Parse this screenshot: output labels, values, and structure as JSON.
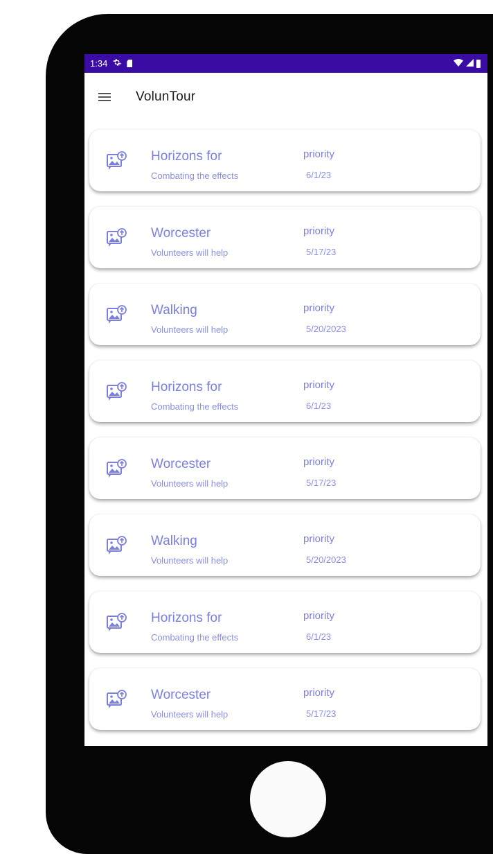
{
  "status_bar": {
    "time": "1:34"
  },
  "app_bar": {
    "title": "VolunTour"
  },
  "colors": {
    "status_bar": "#3a0ca3",
    "accent_text": "#7b7fe0"
  },
  "icons": {
    "menu": "hamburger-menu-icon",
    "thumb": "image-upload-icon"
  },
  "items": [
    {
      "title": "Horizons for",
      "subtitle": "Combating the effects",
      "priority_label": "priority",
      "date": "6/1/23"
    },
    {
      "title": "Worcester",
      "subtitle": "Volunteers will help",
      "priority_label": "priority",
      "date": "5/17/23"
    },
    {
      "title": "Walking",
      "subtitle": "Volunteers will help",
      "priority_label": "priority",
      "date": "5/20/2023"
    },
    {
      "title": "Horizons for",
      "subtitle": "Combating the effects",
      "priority_label": "priority",
      "date": "6/1/23"
    },
    {
      "title": "Worcester",
      "subtitle": "Volunteers will help",
      "priority_label": "priority",
      "date": "5/17/23"
    },
    {
      "title": "Walking",
      "subtitle": "Volunteers will help",
      "priority_label": "priority",
      "date": "5/20/2023"
    },
    {
      "title": "Horizons for",
      "subtitle": "Combating the effects",
      "priority_label": "priority",
      "date": "6/1/23"
    },
    {
      "title": "Worcester",
      "subtitle": "Volunteers will help",
      "priority_label": "priority",
      "date": "5/17/23"
    }
  ]
}
